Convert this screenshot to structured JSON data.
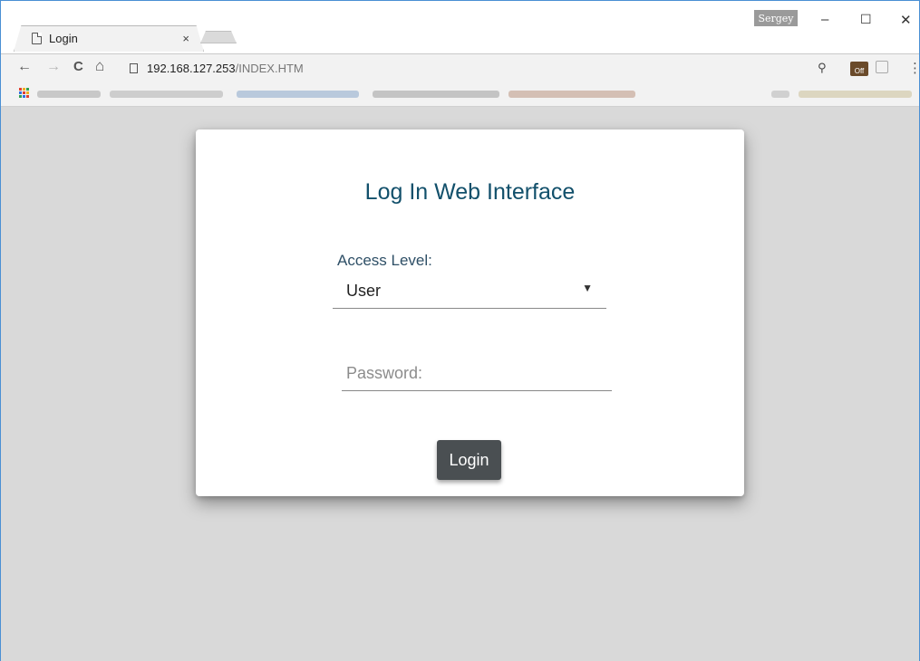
{
  "browser": {
    "tab_title": "Login",
    "tab_close": "×",
    "profile_name": "Sergey",
    "window_controls": {
      "minimize": "–",
      "maximize": "☐",
      "close": "✕"
    },
    "nav": {
      "back": "←",
      "forward": "→",
      "reload": "C",
      "home": "⌂"
    },
    "url_host": "192.168.127.253",
    "url_path": "/INDEX.HTM",
    "extension_off_label": "Off",
    "menu": "⋮"
  },
  "login_card": {
    "title": "Log In Web Interface",
    "access_level_label": "Access Level:",
    "access_level_value": "User",
    "password_placeholder": "Password:",
    "login_button": "Login"
  },
  "colors": {
    "title": "#12506b",
    "button": "#4a4f52",
    "page_background": "#d9d9d9"
  }
}
